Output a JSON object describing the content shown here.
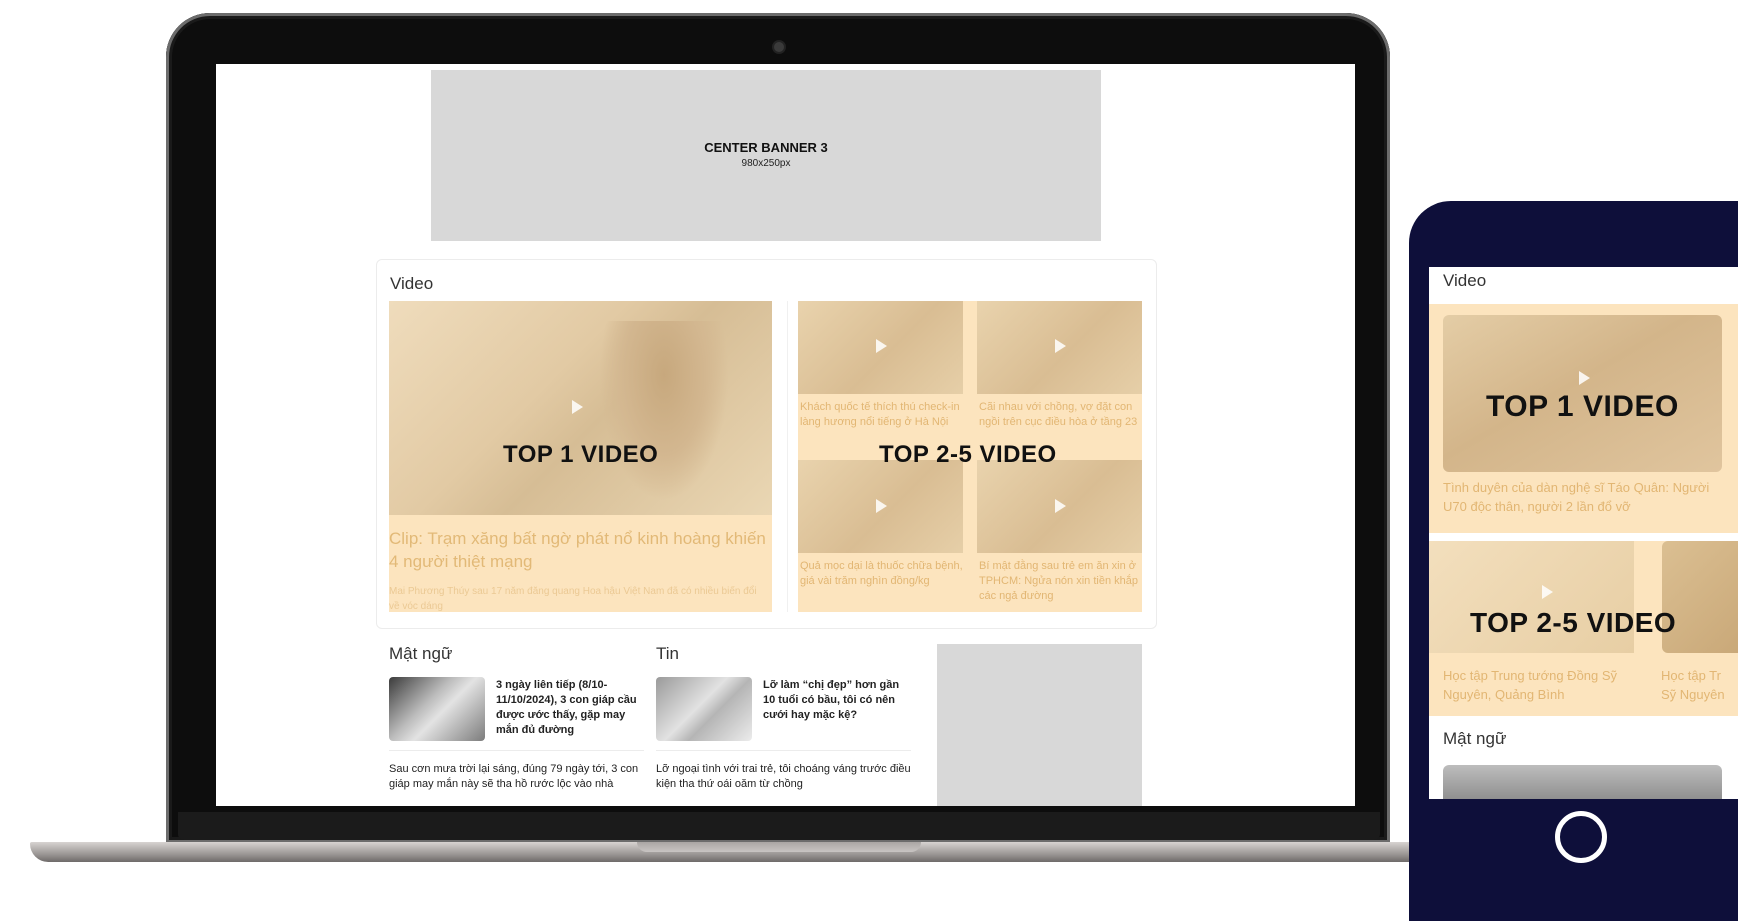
{
  "banner": {
    "title": "CENTER BANNER 3",
    "size": "980x250px"
  },
  "video": {
    "heading": "Video",
    "top1": {
      "overlay": "TOP 1 VIDEO",
      "title": "Clip: Trạm xăng bất ngờ phát nổ kinh hoàng khiến 4 người thiệt mạng",
      "description": "Mai Phương Thúy sau 17 năm đăng quang Hoa hậu Việt Nam đã có nhiều biến đổi về vóc dáng"
    },
    "top25": {
      "overlay": "TOP 2-5 VIDEO",
      "items": [
        {
          "caption": "Khách quốc tế thích thú check-in làng hương nổi tiếng ở Hà Nội"
        },
        {
          "caption": "Cãi nhau với chồng, vợ đặt con ngồi trên cục điều hòa ở tầng 23"
        },
        {
          "caption": "Quả mọc dại là thuốc chữa bệnh, giá vài trăm nghìn đồng/kg"
        },
        {
          "caption": "Bí mật đằng sau trẻ em ăn xin ở TPHCM: Ngửa nón xin tiền khắp các ngả đường"
        }
      ]
    }
  },
  "matngu": {
    "heading": "Mật ngữ",
    "headline": "3 ngày liên tiếp (8/10-11/10/2024), 3 con giáp cầu được ước thấy, gặp may mắn đủ đường",
    "sub": "Sau cơn mưa trời lại sáng, đúng 79 ngày tới, 3 con giáp may mắn này sẽ tha hồ rước lộc vào nhà"
  },
  "tin": {
    "heading": "Tin",
    "headline": "Lỡ làm “chị đẹp” hơn gần 10 tuổi có bầu, tôi có nên cưới hay mặc kệ?",
    "sub": "Lỡ ngoại tình với trai trẻ, tôi choáng váng trước điều kiện tha thứ oái oăm từ chồng"
  },
  "mobile": {
    "video_heading": "Video",
    "top1_overlay": "TOP 1 VIDEO",
    "top1_caption": "Tình duyên của dàn nghệ sĩ Táo Quân: Người U70 độc thân, người 2 lần đổ vỡ",
    "top25_overlay": "TOP 2-5 VIDEO",
    "top25_caption": "Học tập Trung tướng Đồng Sỹ Nguyên, Quảng Bình",
    "top25_caption_2": "Học tập Tr Sỹ Nguyên",
    "matngu_heading": "Mật ngữ"
  },
  "colors": {
    "overlay_tint": "#fce4be",
    "muted_caption": "#e2b673",
    "ad_placeholder": "#d8d8d8",
    "phone_frame": "#0e0f3a"
  }
}
